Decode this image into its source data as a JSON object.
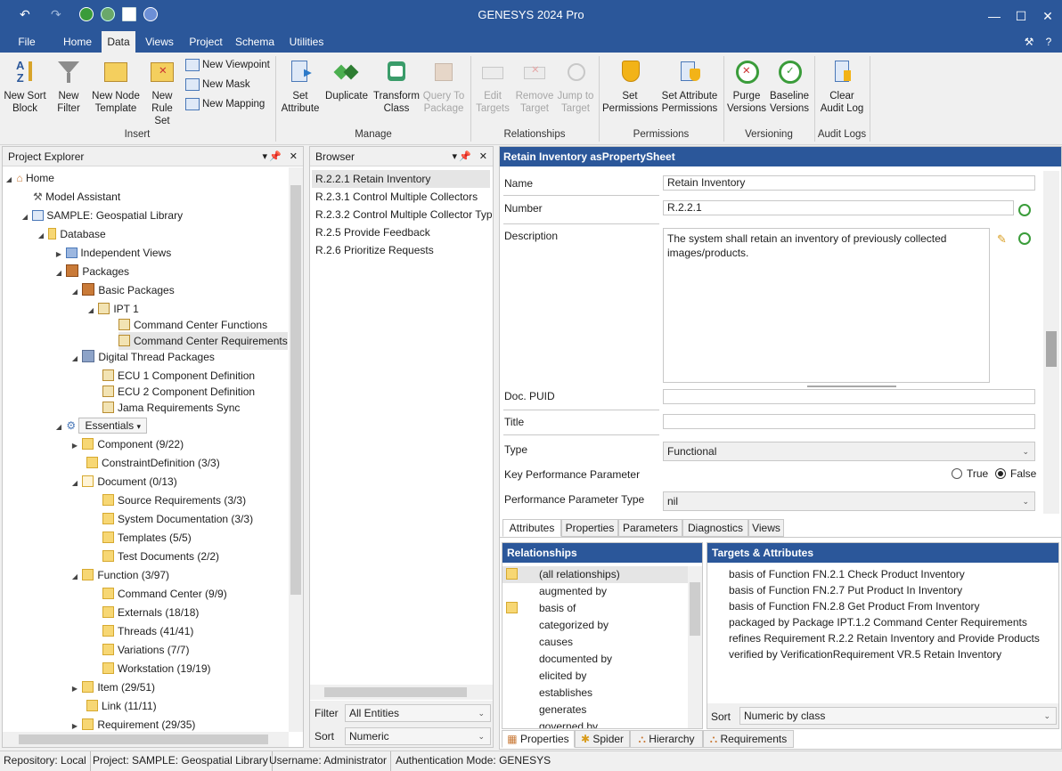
{
  "app": {
    "title": "GENESYS 2024 Pro"
  },
  "menu": {
    "file": "File",
    "home": "Home",
    "data": "Data",
    "views": "Views",
    "project": "Project",
    "schema": "Schema",
    "utilities": "Utilities"
  },
  "ribbon": {
    "new_sort_block_1": "New Sort",
    "new_sort_block_2": "Block",
    "new_filter_1": "New",
    "new_filter_2": "Filter",
    "new_node_template_1": "New Node",
    "new_node_template_2": "Template",
    "new_rule_set_1": "New",
    "new_rule_set_2": "Rule Set",
    "new_viewpoint": "New Viewpoint",
    "new_mask": "New Mask",
    "new_mapping": "New Mapping",
    "set_attribute_1": "Set",
    "set_attribute_2": "Attribute",
    "duplicate": "Duplicate",
    "transform_class_1": "Transform",
    "transform_class_2": "Class",
    "query_to_package_1": "Query To",
    "query_to_package_2": "Package",
    "edit_targets_1": "Edit",
    "edit_targets_2": "Targets",
    "remove_target_1": "Remove",
    "remove_target_2": "Target",
    "jump_to_target_1": "Jump to",
    "jump_to_target_2": "Target",
    "set_permissions_1": "Set",
    "set_permissions_2": "Permissions",
    "set_attr_permissions_1": "Set Attribute",
    "set_attr_permissions_2": "Permissions",
    "purge_versions_1": "Purge",
    "purge_versions_2": "Versions",
    "baseline_versions_1": "Baseline",
    "baseline_versions_2": "Versions",
    "clear_audit_log_1": "Clear",
    "clear_audit_log_2": "Audit Log",
    "groups": {
      "insert": "Insert",
      "manage": "Manage",
      "relationships": "Relationships",
      "permissions": "Permissions",
      "versioning": "Versioning",
      "audit_logs": "Audit Logs"
    }
  },
  "explorer": {
    "title": "Project Explorer",
    "items": {
      "home": "Home",
      "model_assistant": "Model Assistant",
      "library": "SAMPLE: Geospatial Library",
      "database": "Database",
      "independent_views": "Independent Views",
      "packages": "Packages",
      "basic_packages": "Basic Packages",
      "ipt1": "IPT 1",
      "cc_functions": "Command Center Functions",
      "cc_requirements": "Command Center Requirements",
      "digital_thread": "Digital Thread Packages",
      "ecu1": "ECU 1 Component Definition",
      "ecu2": "ECU 2 Component Definition",
      "jama": "Jama Requirements Sync",
      "essentials": "Essentials",
      "component": "Component  (9/22)",
      "constraint": "ConstraintDefinition  (3/3)",
      "document": "Document  (0/13)",
      "source_req": "Source Requirements  (3/3)",
      "system_doc": "System Documentation  (3/3)",
      "templates": "Templates  (5/5)",
      "test_docs": "Test Documents  (2/2)",
      "function": "Function  (3/97)",
      "command_center": "Command Center  (9/9)",
      "externals": "Externals  (18/18)",
      "threads": "Threads  (41/41)",
      "variations": "Variations  (7/7)",
      "workstation": "Workstation  (19/19)",
      "item": "Item  (29/51)",
      "link": "Link  (11/11)",
      "requirement": "Requirement  (29/35)"
    }
  },
  "browser": {
    "title": "Browser",
    "rows": [
      "R.2.2.1 Retain Inventory",
      "R.2.3.1 Control Multiple Collectors",
      "R.2.3.2 Control Multiple Collector Typ",
      "R.2.5 Provide Feedback",
      "R.2.6 Prioritize Requests"
    ],
    "filter_label": "Filter",
    "filter_value": "All Entities",
    "sort_label": "Sort",
    "sort_value": "Numeric"
  },
  "sheet": {
    "title": "Retain Inventory asPropertySheet",
    "name_label": "Name",
    "name_value": "Retain Inventory",
    "number_label": "Number",
    "number_value": "R.2.2.1",
    "description_label": "Description",
    "description_value": "The system shall retain an inventory of previously collected images/products.",
    "doc_puid_label": "Doc. PUID",
    "doc_puid_value": "",
    "title_label": "Title",
    "title_value": "",
    "type_label": "Type",
    "type_value": "Functional",
    "kpp_label": "Key Performance Parameter",
    "kpp_true": "True",
    "kpp_false": "False",
    "kpp_selected": "False",
    "ppt_label": "Performance Parameter Type",
    "ppt_value": "nil",
    "tabs": [
      "Attributes",
      "Properties",
      "Parameters",
      "Diagnostics",
      "Views"
    ]
  },
  "relationships": {
    "title": "Relationships",
    "items": [
      "(all relationships)",
      "augmented by",
      "basis of",
      "categorized by",
      "causes",
      "documented by",
      "elicited by",
      "establishes",
      "generates",
      "governed by"
    ]
  },
  "targets": {
    "title": "Targets & Attributes",
    "items": [
      "basis of Function FN.2.1 Check Product Inventory",
      "basis of Function FN.2.7 Put Product In Inventory",
      "basis of Function FN.2.8 Get Product From Inventory",
      "packaged by Package IPT.1.2 Command Center Requirements",
      "refines Requirement R.2.2 Retain Inventory and Provide Products",
      "verified by VerificationRequirement VR.5 Retain Inventory"
    ],
    "sort_label": "Sort",
    "sort_value": "Numeric by class"
  },
  "bottom_tabs": [
    "Properties",
    "Spider",
    "Hierarchy",
    "Requirements"
  ],
  "status": {
    "repository": "Repository: Local",
    "project": "Project: SAMPLE: Geospatial Library",
    "username": "Username: Administrator",
    "auth": "Authentication Mode: GENESYS"
  },
  "colors": {
    "accent": "#2b579a",
    "selection": "#e5e5e5"
  }
}
